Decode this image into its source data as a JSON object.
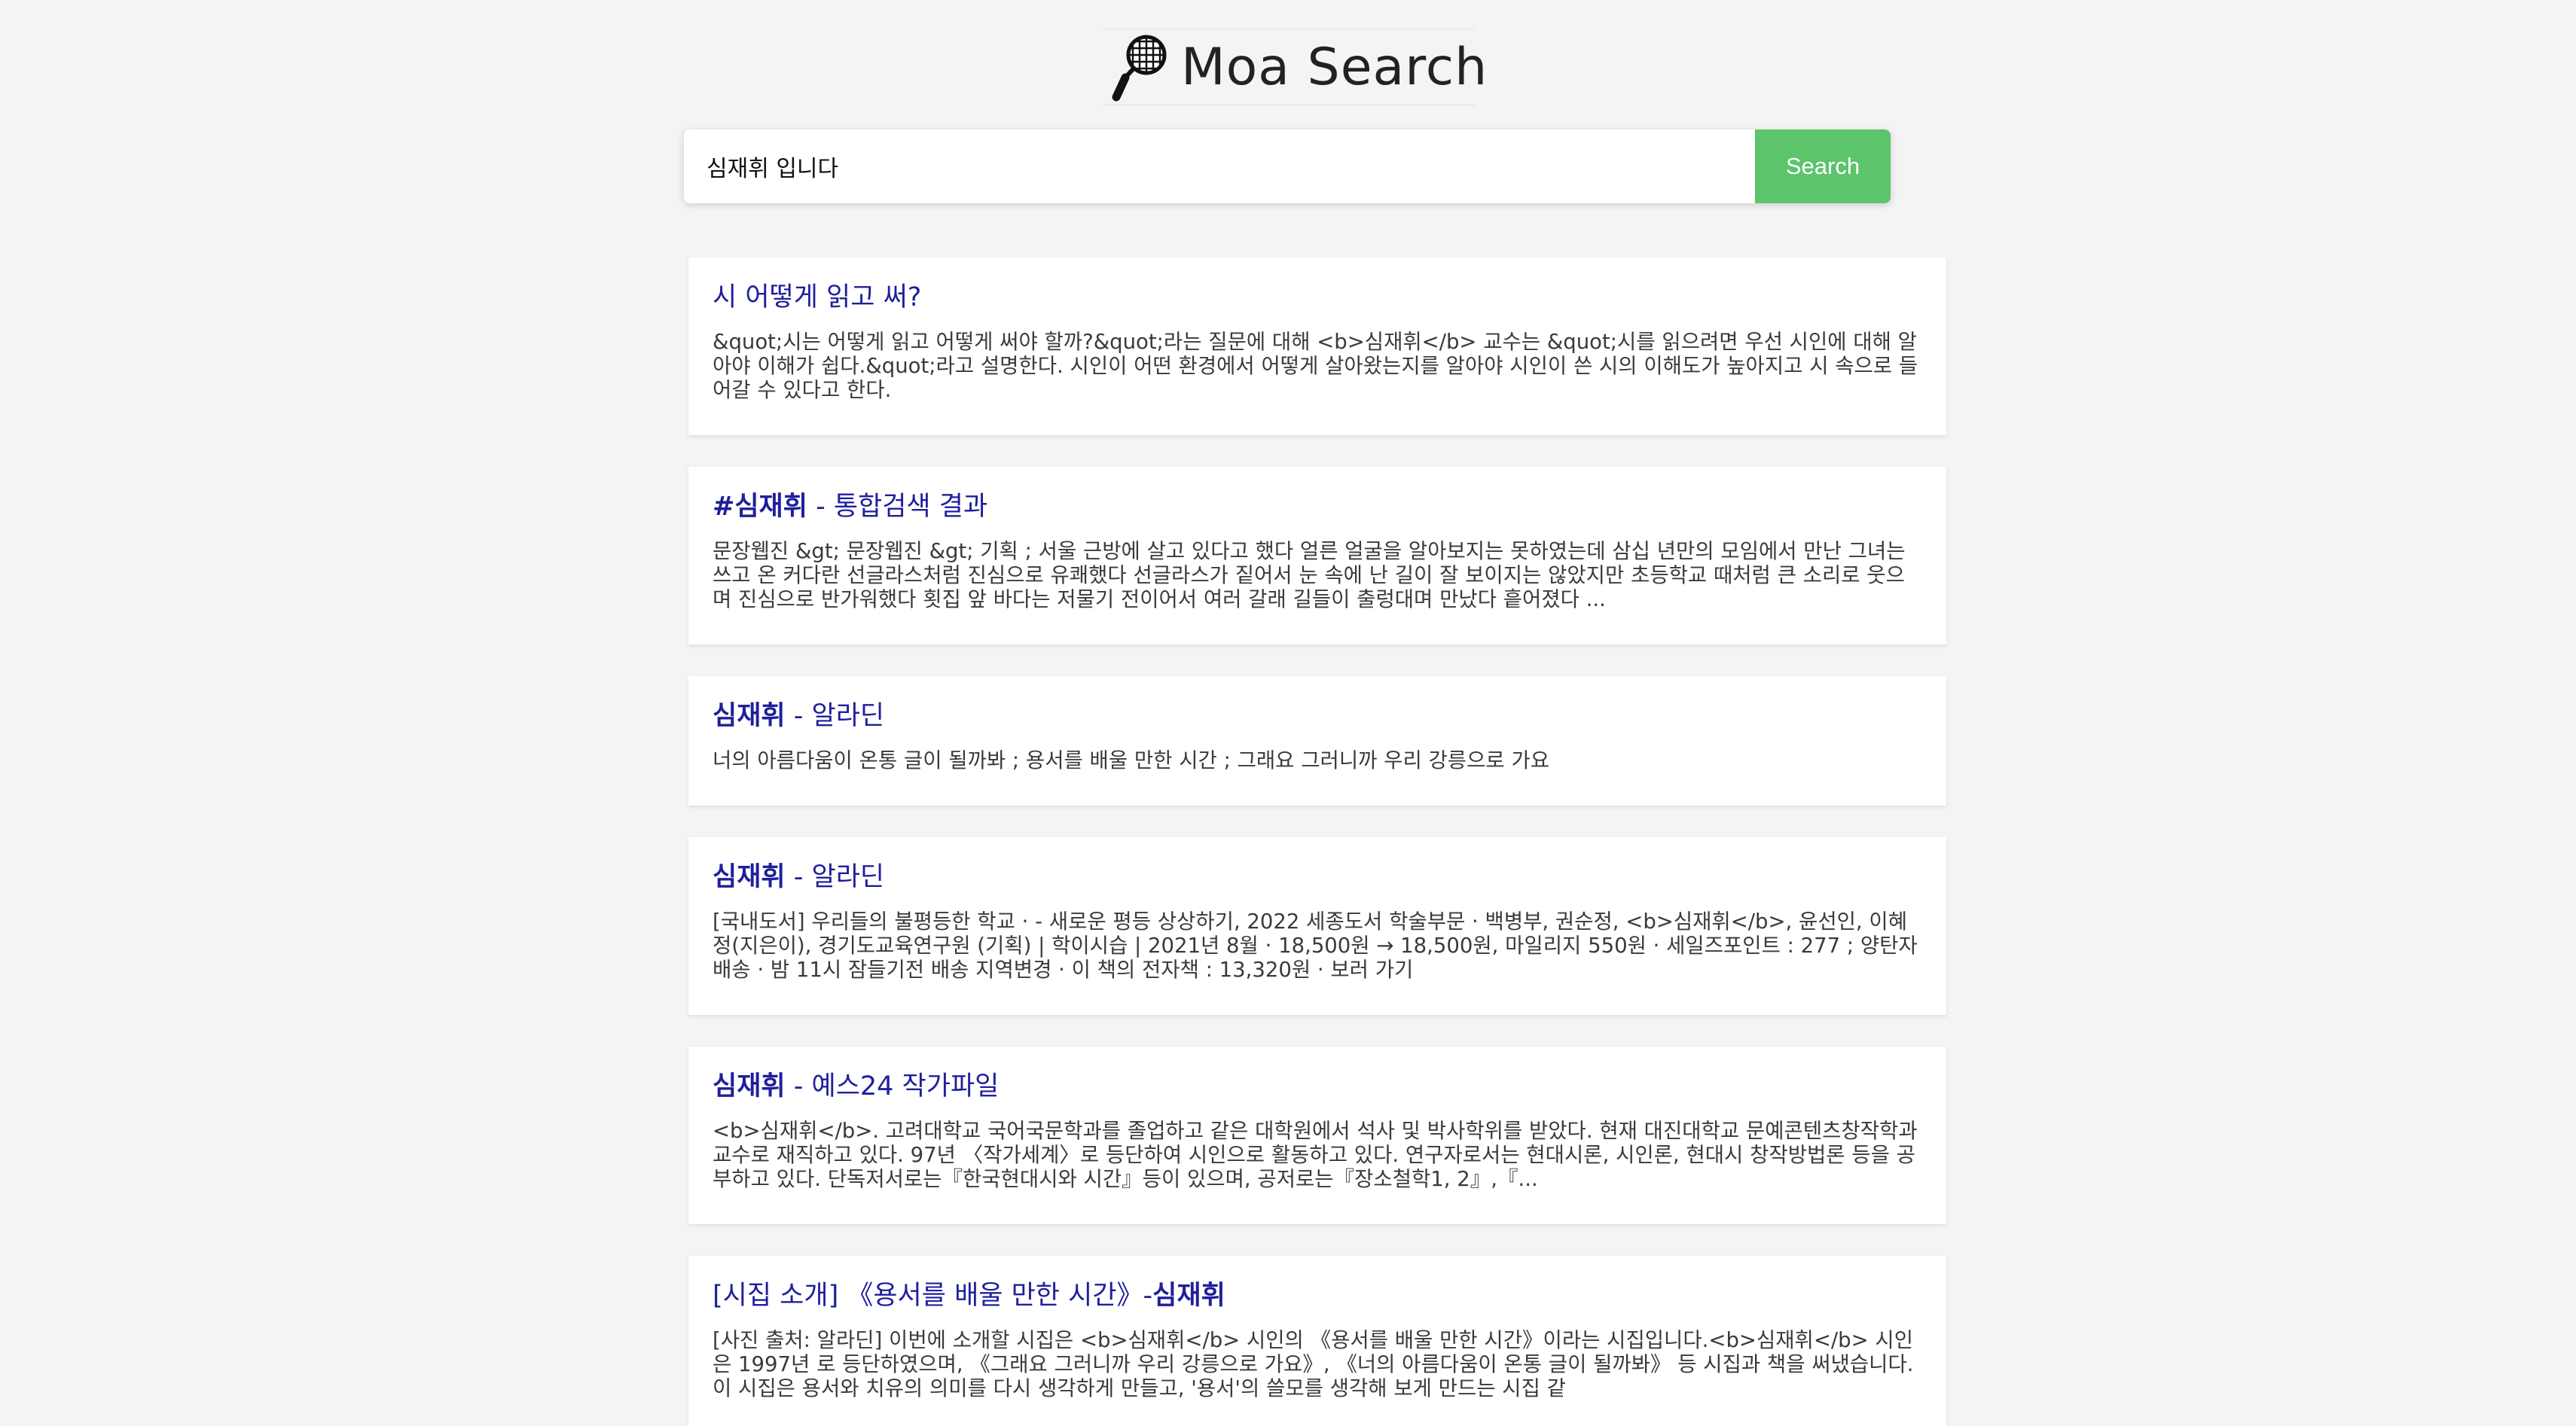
{
  "header": {
    "logo_icon": "badminton-racket-icon",
    "logo_text": "Moa Search"
  },
  "search": {
    "query": "심재휘 입니다",
    "button_label": "Search"
  },
  "results": [
    {
      "title_pre": "",
      "title_bold": "",
      "title_post": "시 어떻게 읽고 써?",
      "snippet": "&quot;시는 어떻게 읽고 어떻게 써야 할까?&quot;라는 질문에 대해 <b>심재휘</b> 교수는 &quot;시를 읽으려면 우선 시인에 대해 알아야 이해가 쉽다.&quot;라고 설명한다. 시인이 어떤 환경에서 어떻게 살아왔는지를 알아야 시인이 쓴 시의 이해도가 높아지고 시 속으로 들어갈 수 있다고 한다."
    },
    {
      "title_pre": "",
      "title_bold": "#심재휘",
      "title_post": " - 통합검색 결과",
      "snippet": "문장웹진 &gt; 문장웹진 &gt; 기획 ; 서울 근방에 살고 있다고 했다 얼른 얼굴을 알아보지는 못하였는데 삼십 년만의 모임에서 만난 그녀는 쓰고 온 커다란 선글라스처럼 진심으로 유쾌했다 선글라스가 짙어서 눈 속에 난 길이 잘 보이지는 않았지만 초등학교 때처럼 큰 소리로 웃으며 진심으로 반가워했다 횟집 앞 바다는 저물기 전이어서 여러 갈래 길들이 출렁대며 만났다 흩어졌다 ..."
    },
    {
      "title_pre": "",
      "title_bold": "심재휘",
      "title_post": " - 알라딘",
      "snippet": "너의 아름다움이 온통 글이 될까봐 ; 용서를 배울 만한 시간 ; 그래요 그러니까 우리 강릉으로 가요"
    },
    {
      "title_pre": "",
      "title_bold": "심재휘",
      "title_post": " - 알라딘",
      "snippet": "[국내도서] 우리들의 불평등한 학교 · - 새로운 평등 상상하기, 2022 세종도서 학술부문 · 백병부, 권순정, <b>심재휘</b>, 윤선인, 이혜정(지은이), 경기도교육연구원 (기획) | 학이시습 | 2021년 8월 · 18,500원 → 18,500원, 마일리지 550원 · 세일즈포인트 : 277 ; 양탄자배송 · 밤 11시 잠들기전 배송 지역변경 · 이 책의 전자책 : 13,320원 · 보러 가기"
    },
    {
      "title_pre": "",
      "title_bold": "심재휘",
      "title_post": " - 예스24 작가파일",
      "snippet": "<b>심재휘</b>. 고려대학교 국어국문학과를 졸업하고 같은 대학원에서 석사 및 박사학위를 받았다. 현재 대진대학교 문예콘텐츠창작학과 교수로 재직하고 있다. 97년 〈작가세계〉로 등단하여 시인으로 활동하고 있다. 연구자로서는 현대시론, 시인론, 현대시 창작방법론 등을 공부하고 있다. 단독저서로는『한국현대시와 시간』등이 있으며, 공저로는『장소철학1, 2』,『..."
    },
    {
      "title_pre": "[시집 소개] 《용서를 배울 만한 시간》-",
      "title_bold": "심재휘",
      "title_post": "",
      "snippet": "[사진 출처: 알라딘] 이번에 소개할 시집은 <b>심재휘</b> 시인의 《용서를 배울 만한 시간》이라는 시집입니다.<b>심재휘</b> 시인은 1997년 로 등단하였으며, 《그래요 그러니까 우리 강릉으로 가요》, 《너의 아름다움이 온통 글이 될까봐》 등 시집과 책을 써냈습니다. 이 시집은 용서와 치유의 의미를 다시 생각하게 만들고, '용서'의 쓸모를 생각해 보게 만드는 시집 같"
    }
  ]
}
